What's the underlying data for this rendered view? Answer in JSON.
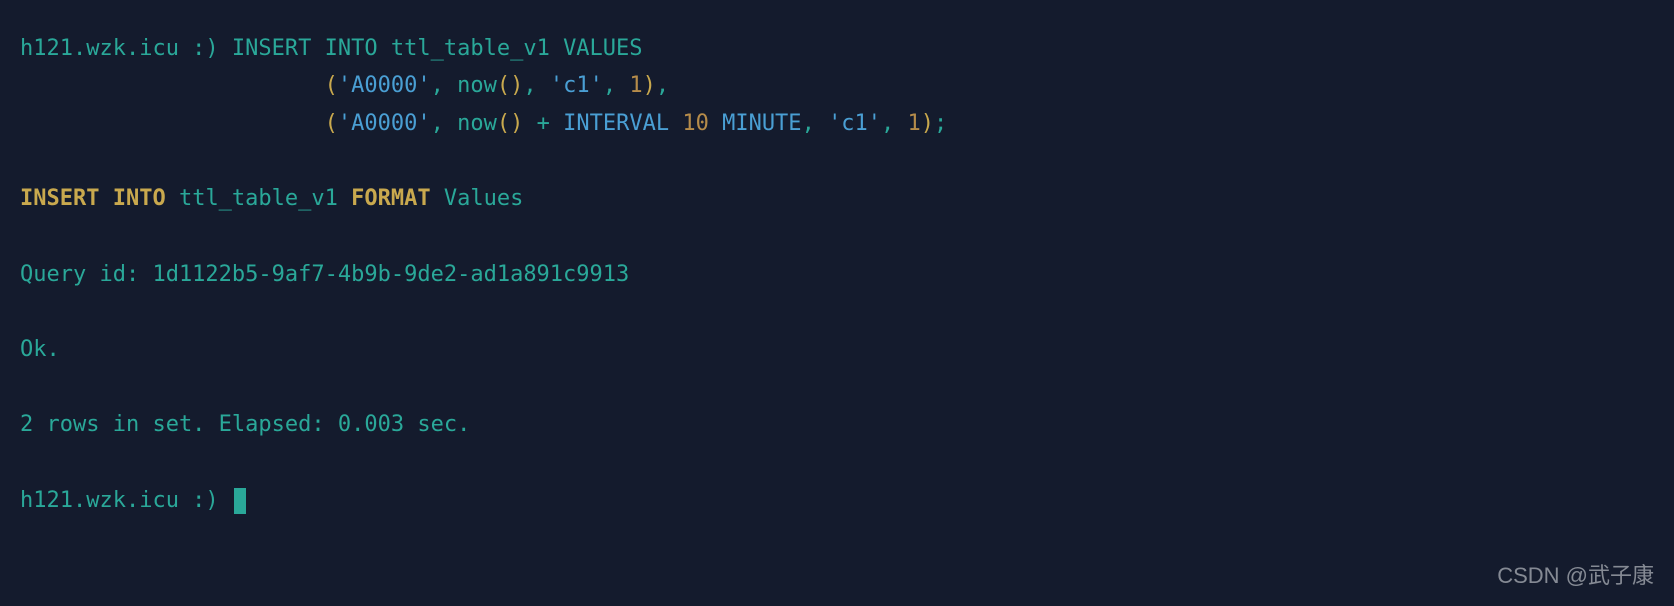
{
  "prompt": {
    "host": "h121.wzk.icu :) ",
    "line1_kw": "INSERT INTO",
    "line1_table": " ttl_table_v1 ",
    "line1_values": "VALUES",
    "indent": "                       ",
    "row1": {
      "open": "(",
      "s1": "'A0000'",
      "c1": ", ",
      "fn": "now",
      "fncall": "()",
      "c2": ", ",
      "s2": "'c1'",
      "c3": ", ",
      "n1": "1",
      "close": ")",
      "end": ","
    },
    "row2": {
      "open": "(",
      "s1": "'A0000'",
      "c1": ", ",
      "fn": "now",
      "fncall": "() ",
      "op": "+",
      "sp": " ",
      "kw1": "INTERVAL",
      "sp2": " ",
      "n10": "10",
      "sp3": " ",
      "kw2": "MINUTE",
      "c2": ", ",
      "s2": "'c1'",
      "c3": ", ",
      "n1": "1",
      "close": ")",
      "end": ";"
    }
  },
  "echo": {
    "kw1": "INSERT INTO",
    "table": " ttl_table_v1 ",
    "kw2": "FORMAT",
    "fmt": " Values"
  },
  "result": {
    "query_id": "Query id: 1d1122b5-9af7-4b9b-9de2-ad1a891c9913",
    "ok": "Ok.",
    "rows": "2 rows in set. Elapsed: 0.003 sec."
  },
  "prompt2": {
    "host": "h121.wzk.icu :) "
  },
  "watermark": "CSDN @武子康"
}
